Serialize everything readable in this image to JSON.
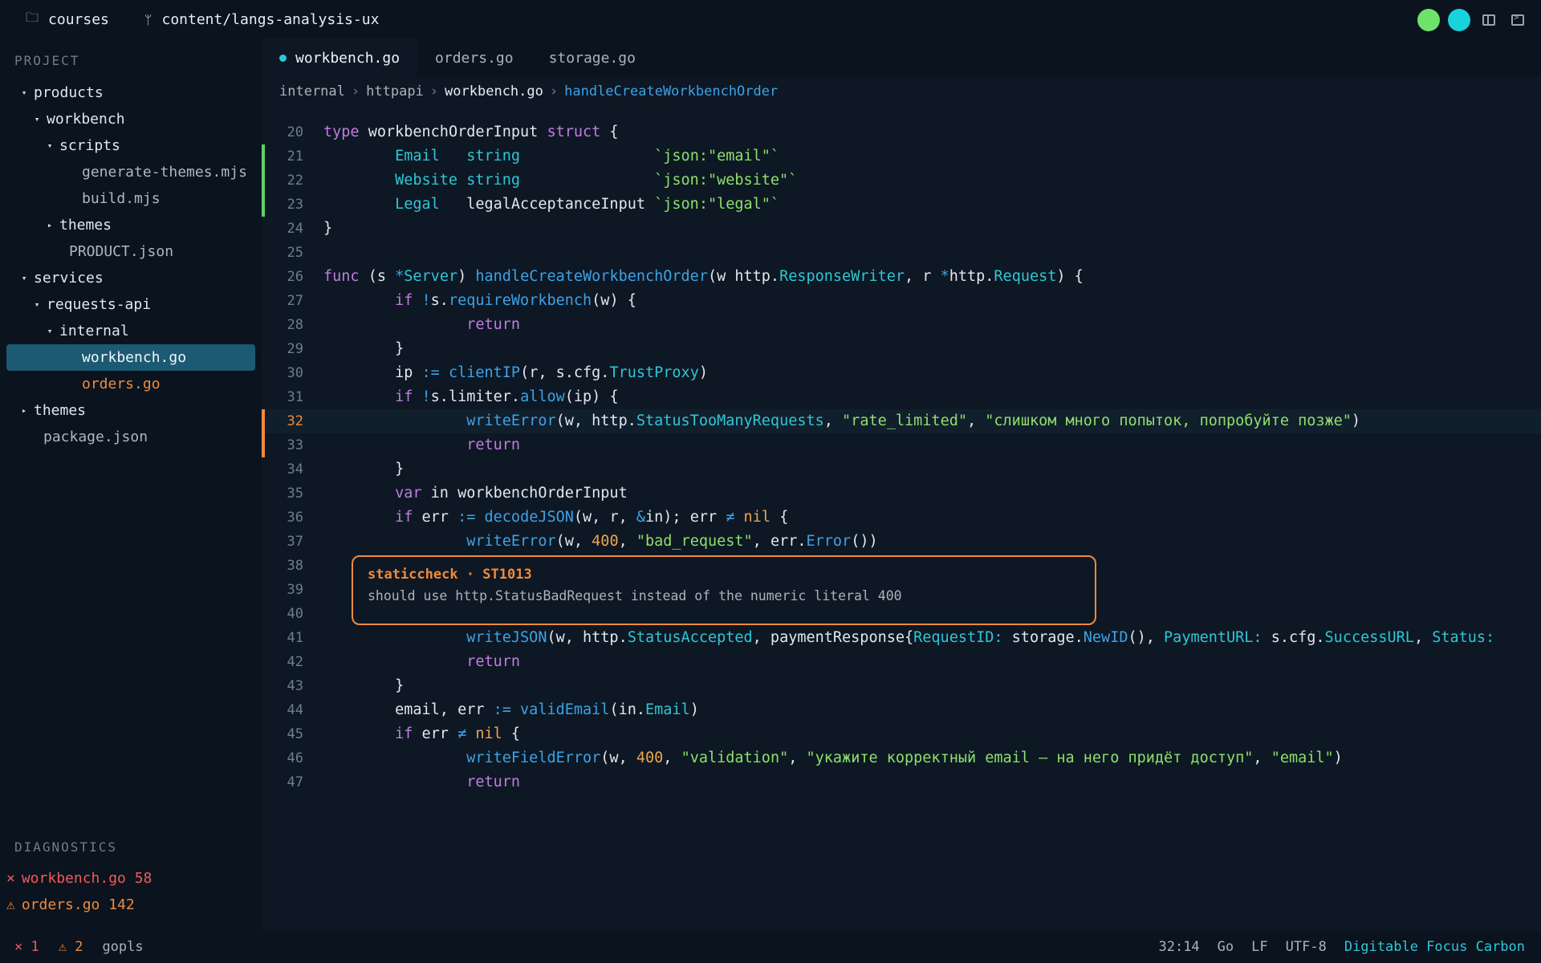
{
  "topbar": {
    "project_name": "courses",
    "branch": "content/langs-analysis-ux",
    "colors": {
      "dot1": "#6ee36a",
      "dot2": "#19d3dc"
    }
  },
  "sidebar": {
    "title": "PROJECT",
    "tree": [
      {
        "label": "products",
        "depth": 0,
        "arrow": "▾"
      },
      {
        "label": "workbench",
        "depth": 1,
        "arrow": "▾"
      },
      {
        "label": "scripts",
        "depth": 2,
        "arrow": "▾"
      },
      {
        "label": "generate-themes.mjs",
        "depth": 3,
        "arrow": ""
      },
      {
        "label": "build.mjs",
        "depth": 3,
        "arrow": ""
      },
      {
        "label": "themes",
        "depth": 2,
        "arrow": "▸"
      },
      {
        "label": "PRODUCT.json",
        "depth": 2,
        "arrow": ""
      },
      {
        "label": "services",
        "depth": 0,
        "arrow": "▾"
      },
      {
        "label": "requests-api",
        "depth": 1,
        "arrow": "▾"
      },
      {
        "label": "internal",
        "depth": 2,
        "arrow": "▾"
      },
      {
        "label": "workbench.go",
        "depth": 3,
        "arrow": "",
        "state": "selected"
      },
      {
        "label": "orders.go",
        "depth": 3,
        "arrow": "",
        "state": "warn"
      },
      {
        "label": "themes",
        "depth": 0,
        "arrow": "▸"
      },
      {
        "label": "package.json",
        "depth": 0,
        "arrow": ""
      }
    ],
    "diagnostics_title": "DIAGNOSTICS",
    "diagnostics": [
      {
        "icon": "×",
        "text": "workbench.go 58",
        "kind": "error"
      },
      {
        "icon": "⚠",
        "text": "orders.go 142",
        "kind": "warning"
      }
    ]
  },
  "tabs": [
    {
      "label": "workbench.go",
      "modified": true
    },
    {
      "label": "orders.go"
    },
    {
      "label": "storage.go"
    }
  ],
  "breadcrumb": [
    "internal",
    "httpapi",
    "workbench.go",
    "handleCreateWorkbenchOrder"
  ],
  "code": [
    {
      "n": "20",
      "tokens": [
        [
          "kw",
          "type"
        ],
        [
          "pl",
          " workbenchOrderInput "
        ],
        [
          "kw",
          "struct"
        ],
        [
          "pl",
          " {"
        ]
      ]
    },
    {
      "n": "21",
      "mark": "add",
      "tokens": [
        [
          "pl",
          "        "
        ],
        [
          "ty",
          "Email"
        ],
        [
          "pl",
          "   "
        ],
        [
          "ty",
          "string"
        ],
        [
          "pl",
          "               "
        ],
        [
          "st",
          "`json:\"email\"`"
        ]
      ]
    },
    {
      "n": "22",
      "mark": "add",
      "tokens": [
        [
          "pl",
          "        "
        ],
        [
          "ty",
          "Website"
        ],
        [
          "pl",
          " "
        ],
        [
          "ty",
          "string"
        ],
        [
          "pl",
          "               "
        ],
        [
          "st",
          "`json:\"website\"`"
        ]
      ]
    },
    {
      "n": "23",
      "mark": "add",
      "tokens": [
        [
          "pl",
          "        "
        ],
        [
          "ty",
          "Legal"
        ],
        [
          "pl",
          "   legalAcceptanceInput "
        ],
        [
          "st",
          "`json:\"legal\"`"
        ]
      ]
    },
    {
      "n": "24",
      "tokens": [
        [
          "pl",
          "}"
        ]
      ]
    },
    {
      "n": "25",
      "tokens": []
    },
    {
      "n": "26",
      "tokens": [
        [
          "kw",
          "func"
        ],
        [
          "pl",
          " (s "
        ],
        [
          "op",
          "*"
        ],
        [
          "ty",
          "Server"
        ],
        [
          "pl",
          ") "
        ],
        [
          "fn",
          "handleCreateWorkbenchOrder"
        ],
        [
          "pl",
          "(w http."
        ],
        [
          "ty",
          "ResponseWriter"
        ],
        [
          "pl",
          ", r "
        ],
        [
          "op",
          "*"
        ],
        [
          "pl",
          "http."
        ],
        [
          "ty",
          "Request"
        ],
        [
          "pl",
          ") {"
        ]
      ]
    },
    {
      "n": "27",
      "tokens": [
        [
          "pl",
          "        "
        ],
        [
          "kw",
          "if"
        ],
        [
          "pl",
          " "
        ],
        [
          "op",
          "!"
        ],
        [
          "pl",
          "s."
        ],
        [
          "fn",
          "requireWorkbench"
        ],
        [
          "pl",
          "(w) {"
        ]
      ]
    },
    {
      "n": "28",
      "tokens": [
        [
          "pl",
          "                "
        ],
        [
          "kw",
          "return"
        ]
      ]
    },
    {
      "n": "29",
      "tokens": [
        [
          "pl",
          "        }"
        ]
      ]
    },
    {
      "n": "30",
      "tokens": [
        [
          "pl",
          "        ip "
        ],
        [
          "op",
          ":="
        ],
        [
          "pl",
          " "
        ],
        [
          "fn",
          "clientIP"
        ],
        [
          "pl",
          "(r, s.cfg."
        ],
        [
          "ty",
          "TrustProxy"
        ],
        [
          "pl",
          ")"
        ]
      ]
    },
    {
      "n": "31",
      "tokens": [
        [
          "pl",
          "        "
        ],
        [
          "kw",
          "if"
        ],
        [
          "pl",
          " "
        ],
        [
          "op",
          "!"
        ],
        [
          "pl",
          "s.limiter."
        ],
        [
          "fn",
          "allow"
        ],
        [
          "pl",
          "(ip) {"
        ]
      ]
    },
    {
      "n": "32",
      "mark": "mod",
      "hl": true,
      "tokens": [
        [
          "pl",
          "                "
        ],
        [
          "fn",
          "writeError"
        ],
        [
          "pl",
          "(w, http."
        ],
        [
          "ty",
          "StatusTooManyRequests"
        ],
        [
          "pl",
          ", "
        ],
        [
          "st",
          "\"rate_limited\""
        ],
        [
          "pl",
          ", "
        ],
        [
          "st",
          "\"слишком много попыток, попробуйте позже\""
        ],
        [
          "pl",
          ")"
        ]
      ]
    },
    {
      "n": "33",
      "mark": "mod",
      "tokens": [
        [
          "pl",
          "                "
        ],
        [
          "kw",
          "return"
        ]
      ]
    },
    {
      "n": "34",
      "tokens": [
        [
          "pl",
          "        }"
        ]
      ]
    },
    {
      "n": "35",
      "tokens": [
        [
          "pl",
          "        "
        ],
        [
          "kw",
          "var"
        ],
        [
          "pl",
          " in workbenchOrderInput"
        ]
      ]
    },
    {
      "n": "36",
      "tokens": [
        [
          "pl",
          "        "
        ],
        [
          "kw",
          "if"
        ],
        [
          "pl",
          " err "
        ],
        [
          "op",
          ":="
        ],
        [
          "pl",
          " "
        ],
        [
          "fn",
          "decodeJSON"
        ],
        [
          "pl",
          "(w, r, "
        ],
        [
          "op",
          "&"
        ],
        [
          "pl",
          "in); err "
        ],
        [
          "op",
          "≠"
        ],
        [
          "pl",
          " "
        ],
        [
          "nm",
          "nil"
        ],
        [
          "pl",
          " {"
        ]
      ]
    },
    {
      "n": "37",
      "tokens": [
        [
          "pl",
          "                "
        ],
        [
          "fn",
          "writeError"
        ],
        [
          "pl",
          "(w, "
        ],
        [
          "nm",
          "400"
        ],
        [
          "pl",
          ", "
        ],
        [
          "st",
          "\"bad_request\""
        ],
        [
          "pl",
          ", err."
        ],
        [
          "fn",
          "Error"
        ],
        [
          "pl",
          "())"
        ]
      ]
    },
    {
      "n": "38",
      "tokens": []
    },
    {
      "n": "39",
      "tokens": []
    },
    {
      "n": "40",
      "tokens": []
    },
    {
      "n": "41",
      "tokens": [
        [
          "pl",
          "                "
        ],
        [
          "fn",
          "writeJSON"
        ],
        [
          "pl",
          "(w, http."
        ],
        [
          "ty",
          "StatusAccepted"
        ],
        [
          "pl",
          ", paymentResponse{"
        ],
        [
          "ty",
          "RequestID:"
        ],
        [
          "pl",
          " storage."
        ],
        [
          "fn",
          "NewID"
        ],
        [
          "pl",
          "(), "
        ],
        [
          "ty",
          "PaymentURL:"
        ],
        [
          "pl",
          " s.cfg."
        ],
        [
          "ty",
          "SuccessURL"
        ],
        [
          "pl",
          ", "
        ],
        [
          "ty",
          "Status:"
        ]
      ]
    },
    {
      "n": "42",
      "tokens": [
        [
          "pl",
          "                "
        ],
        [
          "kw",
          "return"
        ]
      ]
    },
    {
      "n": "43",
      "tokens": [
        [
          "pl",
          "        }"
        ]
      ]
    },
    {
      "n": "44",
      "tokens": [
        [
          "pl",
          "        email, err "
        ],
        [
          "op",
          ":="
        ],
        [
          "pl",
          " "
        ],
        [
          "fn",
          "validEmail"
        ],
        [
          "pl",
          "(in."
        ],
        [
          "ty",
          "Email"
        ],
        [
          "pl",
          ")"
        ]
      ]
    },
    {
      "n": "45",
      "tokens": [
        [
          "pl",
          "        "
        ],
        [
          "kw",
          "if"
        ],
        [
          "pl",
          " err "
        ],
        [
          "op",
          "≠"
        ],
        [
          "pl",
          " "
        ],
        [
          "nm",
          "nil"
        ],
        [
          "pl",
          " {"
        ]
      ]
    },
    {
      "n": "46",
      "tokens": [
        [
          "pl",
          "                "
        ],
        [
          "fn",
          "writeFieldError"
        ],
        [
          "pl",
          "(w, "
        ],
        [
          "nm",
          "400"
        ],
        [
          "pl",
          ", "
        ],
        [
          "st",
          "\"validation\""
        ],
        [
          "pl",
          ", "
        ],
        [
          "st",
          "\"укажите корректный email — на него придёт доступ\""
        ],
        [
          "pl",
          ", "
        ],
        [
          "st",
          "\"email\""
        ],
        [
          "pl",
          ")"
        ]
      ]
    },
    {
      "n": "47",
      "tokens": [
        [
          "pl",
          "                "
        ],
        [
          "kw",
          "return"
        ]
      ]
    }
  ],
  "popup": {
    "title": "staticcheck · ST1013",
    "message": "should use http.StatusBadRequest instead of the numeric literal 400"
  },
  "statusbar": {
    "errors": "× 1",
    "warnings": "⚠ 2",
    "lsp": "gopls",
    "cursor": "32:14",
    "language": "Go",
    "eol": "LF",
    "encoding": "UTF-8",
    "theme": "Digitable Focus Carbon"
  }
}
